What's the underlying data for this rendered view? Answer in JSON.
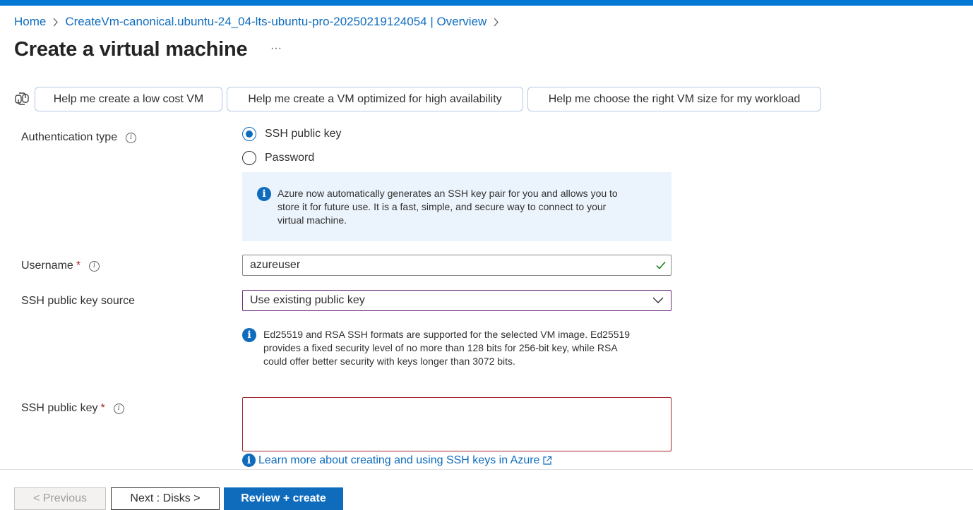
{
  "breadcrumb": {
    "items": [
      {
        "label": "Home"
      },
      {
        "label": "CreateVm-canonical.ubuntu-24_04-lts-ubuntu-pro-20250219124054 | Overview"
      }
    ]
  },
  "page": {
    "title": "Create a virtual machine",
    "more_label": "···"
  },
  "copilot": {
    "icon": "copilot-icon",
    "prompts": [
      {
        "label": "Help me create a low cost VM"
      },
      {
        "label": "Help me create a VM optimized for high availability"
      },
      {
        "label": "Help me choose the right VM size for my workload"
      }
    ]
  },
  "auth": {
    "label": "Authentication type",
    "options": [
      {
        "label": "SSH public key",
        "selected": true
      },
      {
        "label": "Password",
        "selected": false
      }
    ],
    "info_lines": [
      "Azure now automatically generates an SSH key pair for you and allows you to",
      "store it for future use. It is a fast, simple, and secure way to connect to your",
      "virtual machine."
    ]
  },
  "username": {
    "label": "Username",
    "required_mark": "*",
    "value": "azureuser"
  },
  "key_source": {
    "label": "SSH public key source",
    "selected": "Use existing public key",
    "info_lines": [
      "Ed25519 and RSA SSH formats are supported for the selected VM image. Ed25519",
      "provides a fixed security level of no more than 128 bits for 256-bit key, while RSA",
      "could offer better security with keys longer than 3072 bits."
    ]
  },
  "public_key": {
    "label": "SSH public key",
    "required_mark": "*",
    "value": "",
    "learn_more": "Learn more about creating and using SSH keys in Azure"
  },
  "footer": {
    "previous": "< Previous",
    "next": "Next : Disks >",
    "review": "Review + create"
  },
  "colors": {
    "accent": "#0f6cbd",
    "top_bar": "#0078d4",
    "required": "#a4262c",
    "success": "#107c10",
    "info_bg": "#ebf3fc"
  }
}
